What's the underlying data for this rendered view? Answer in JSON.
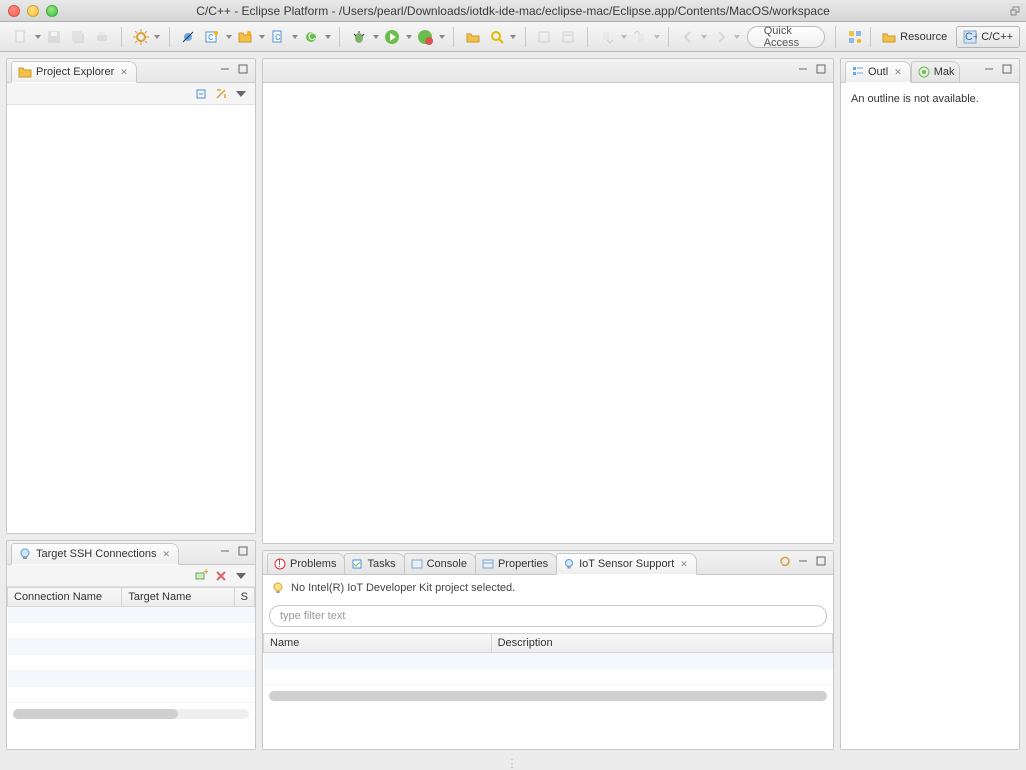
{
  "window": {
    "title": "C/C++ - Eclipse Platform - /Users/pearl/Downloads/iotdk-ide-mac/eclipse-mac/Eclipse.app/Contents/MacOS/workspace"
  },
  "toolbar": {
    "quick_access": "Quick Access",
    "perspectives": {
      "resource": "Resource",
      "ccpp": "C/C++"
    }
  },
  "left": {
    "project_explorer": {
      "title": "Project Explorer"
    },
    "ssh": {
      "title": "Target SSH Connections",
      "columns": {
        "conn": "Connection Name",
        "target": "Target Name",
        "status_abbrev": "S"
      }
    }
  },
  "mid": {
    "bottom_tabs": {
      "problems": "Problems",
      "tasks": "Tasks",
      "console": "Console",
      "properties": "Properties",
      "iot": "IoT Sensor Support"
    },
    "iot": {
      "message": "No Intel(R) IoT Developer Kit project selected.",
      "filter_placeholder": "type filter text",
      "columns": {
        "name": "Name",
        "description": "Description"
      }
    }
  },
  "right": {
    "outline": {
      "tab_label": "Outl",
      "make_tab": "Mak",
      "message": "An outline is not available."
    }
  }
}
